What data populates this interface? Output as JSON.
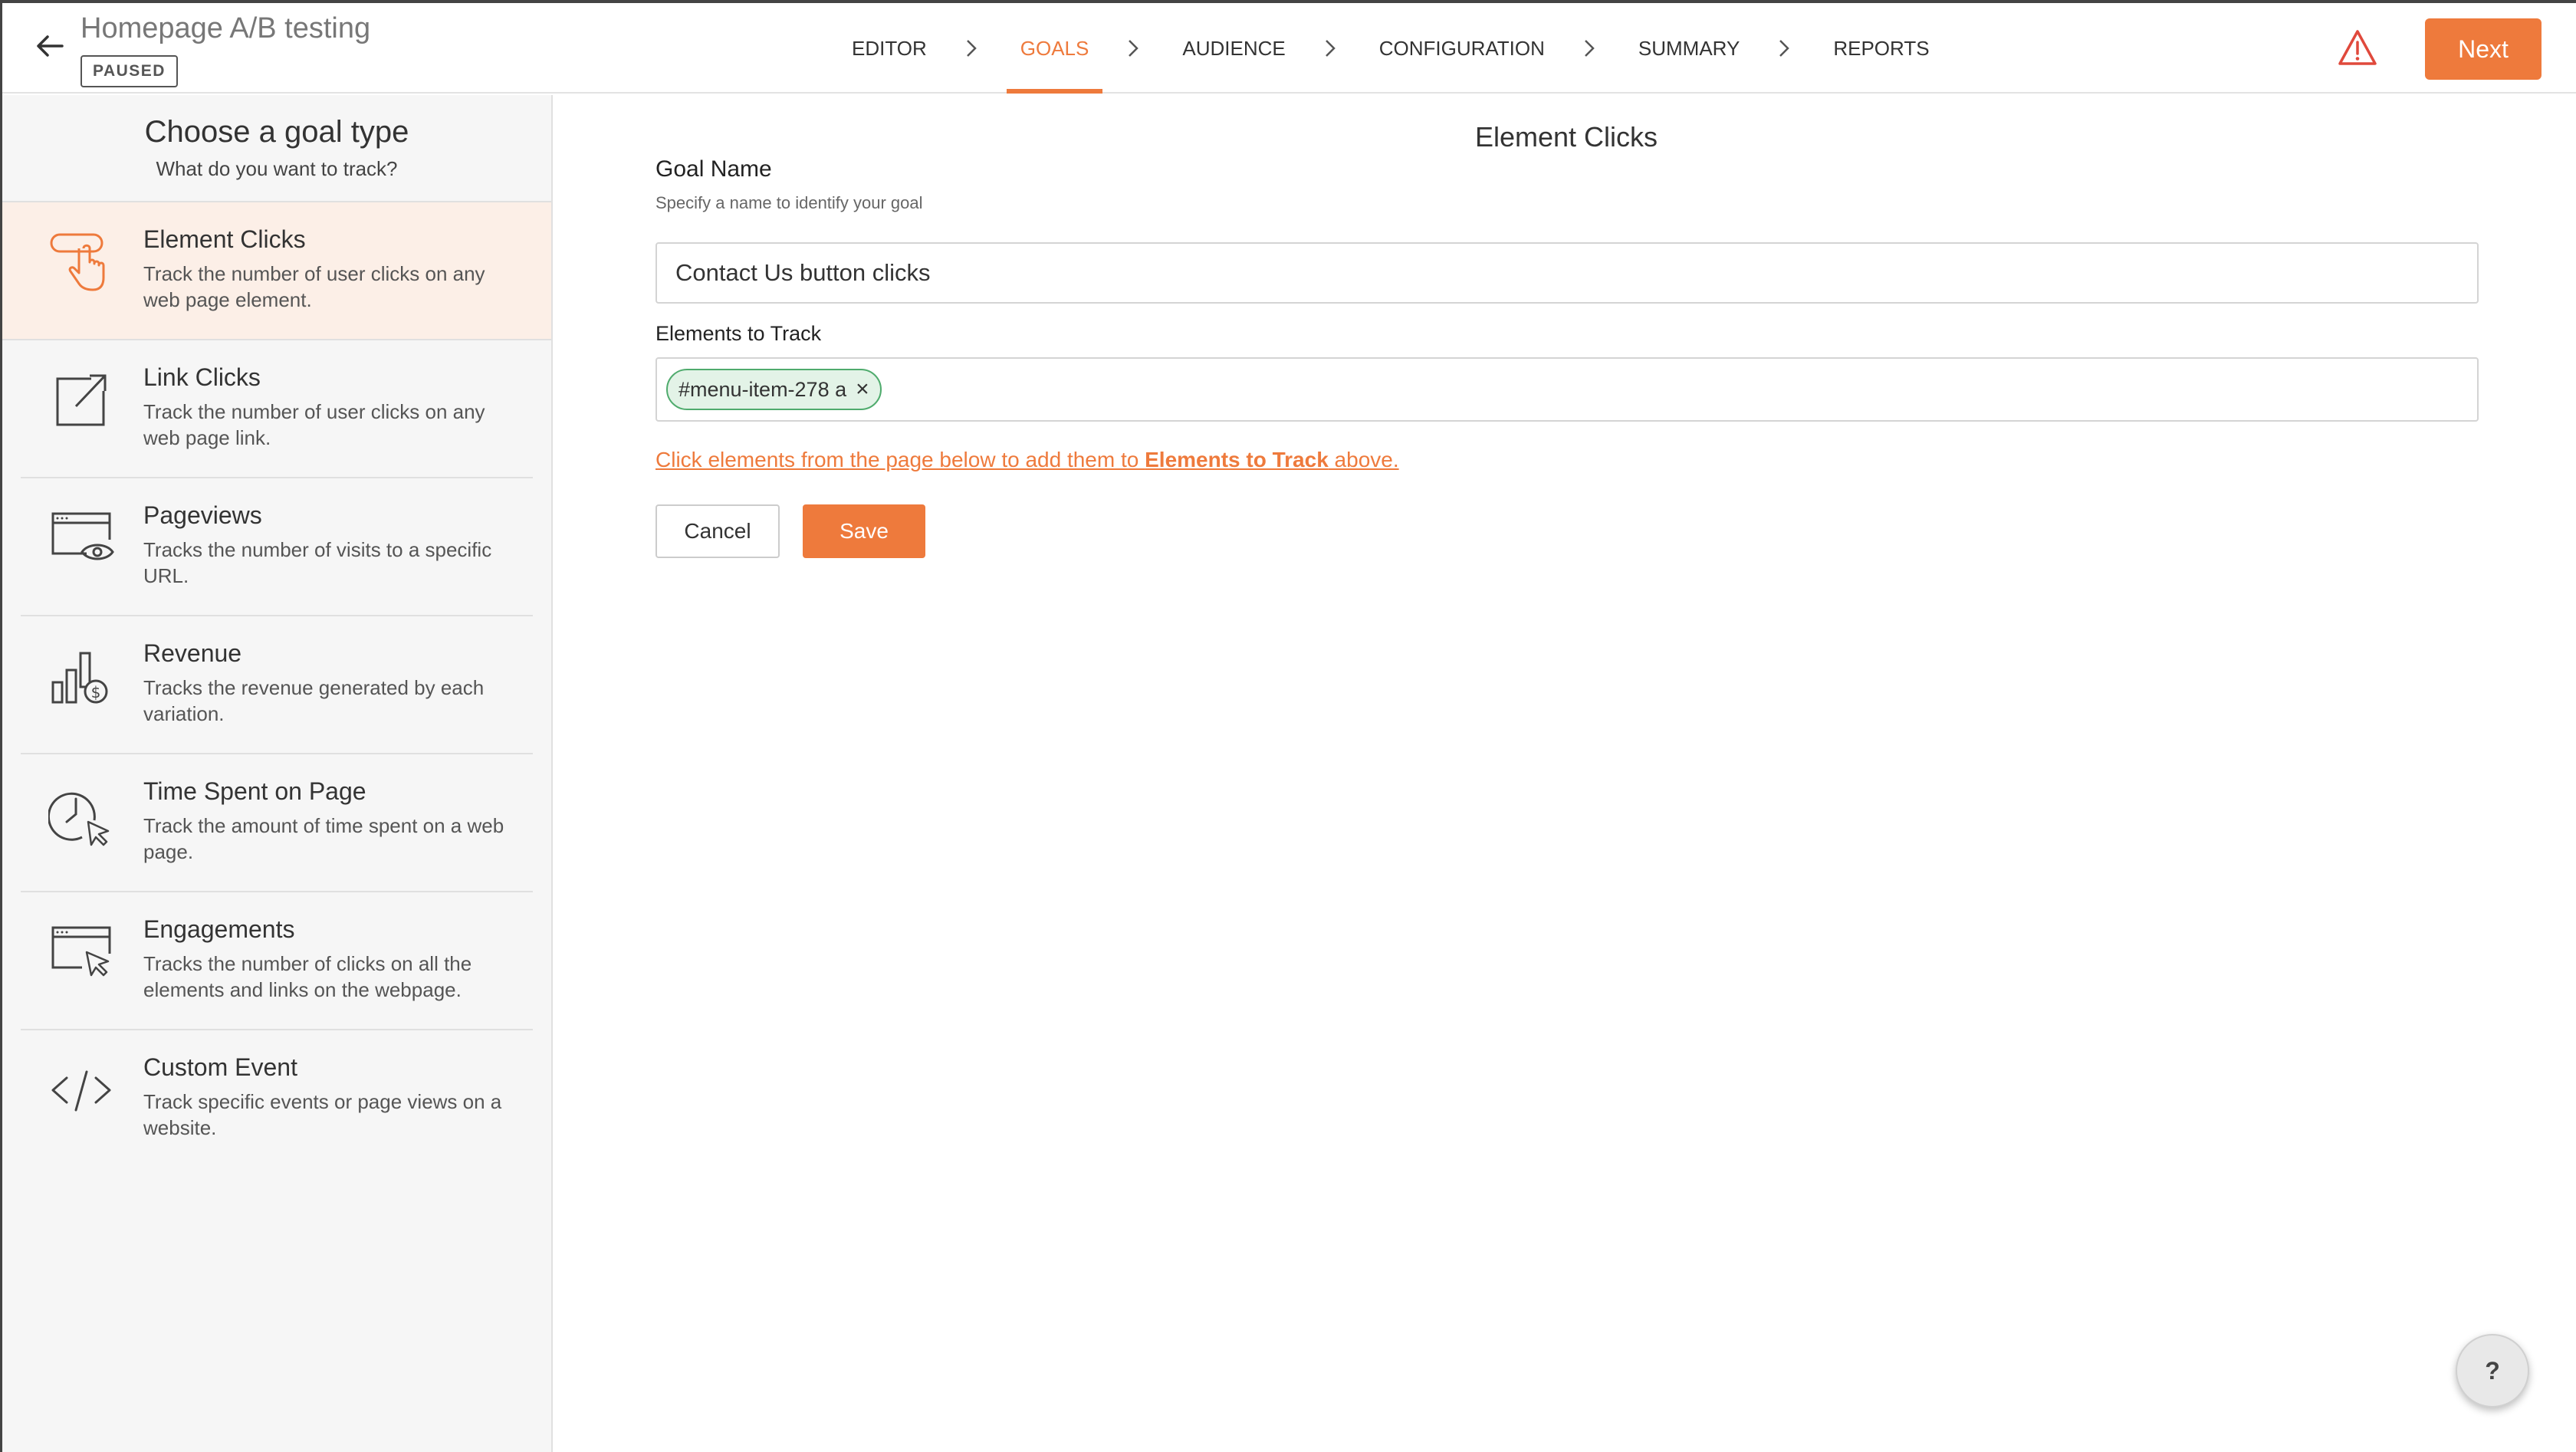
{
  "header": {
    "title": "Homepage A/B testing",
    "status": "PAUSED",
    "steps": [
      {
        "label": "EDITOR"
      },
      {
        "label": "GOALS"
      },
      {
        "label": "AUDIENCE"
      },
      {
        "label": "CONFIGURATION"
      },
      {
        "label": "SUMMARY"
      },
      {
        "label": "REPORTS"
      }
    ],
    "active_step": "GOALS",
    "next_label": "Next",
    "icons": {
      "back": "arrow-left-icon",
      "warning": "warning-triangle-icon",
      "separator": "chevron-right-icon"
    }
  },
  "sidebar": {
    "title": "Choose a goal type",
    "subtitle": "What do you want to track?",
    "items": [
      {
        "title": "Element Clicks",
        "desc": "Track the number of user clicks on any web page element.",
        "icon": "pointer-click-icon",
        "active": true
      },
      {
        "title": "Link Clicks",
        "desc": "Track the number of user clicks on any web page link.",
        "icon": "external-link-icon"
      },
      {
        "title": "Pageviews",
        "desc": "Tracks the number of visits to a specific URL.",
        "icon": "browser-eye-icon"
      },
      {
        "title": "Revenue",
        "desc": "Tracks the revenue generated by each variation.",
        "icon": "bar-dollar-icon"
      },
      {
        "title": "Time Spent on Page",
        "desc": "Track the amount of time spent on a web page.",
        "icon": "clock-cursor-icon"
      },
      {
        "title": "Engagements",
        "desc": "Tracks the number of clicks on all the elements and links on the webpage.",
        "icon": "browser-cursor-icon"
      },
      {
        "title": "Custom Event",
        "desc": "Track specific events or page views on a website.",
        "icon": "code-icon"
      }
    ]
  },
  "main": {
    "title": "Element Clicks",
    "goal_name_label": "Goal Name",
    "goal_name_help": "Specify a name to identify your goal",
    "goal_name_value": "Contact Us button clicks",
    "elements_label": "Elements to Track",
    "elements": [
      {
        "selector": "#menu-item-278 a",
        "remove": "×"
      }
    ],
    "hint_prefix": "Click elements from the page below to add them to ",
    "hint_bold": "Elements to Track",
    "hint_suffix": " above.",
    "cancel_label": "Cancel",
    "save_label": "Save"
  },
  "help_label": "?",
  "colors": {
    "accent": "#ee7a3c",
    "chip_border": "#4fab6d",
    "chip_bg": "#e3f3e7",
    "warning": "#e0493c"
  }
}
